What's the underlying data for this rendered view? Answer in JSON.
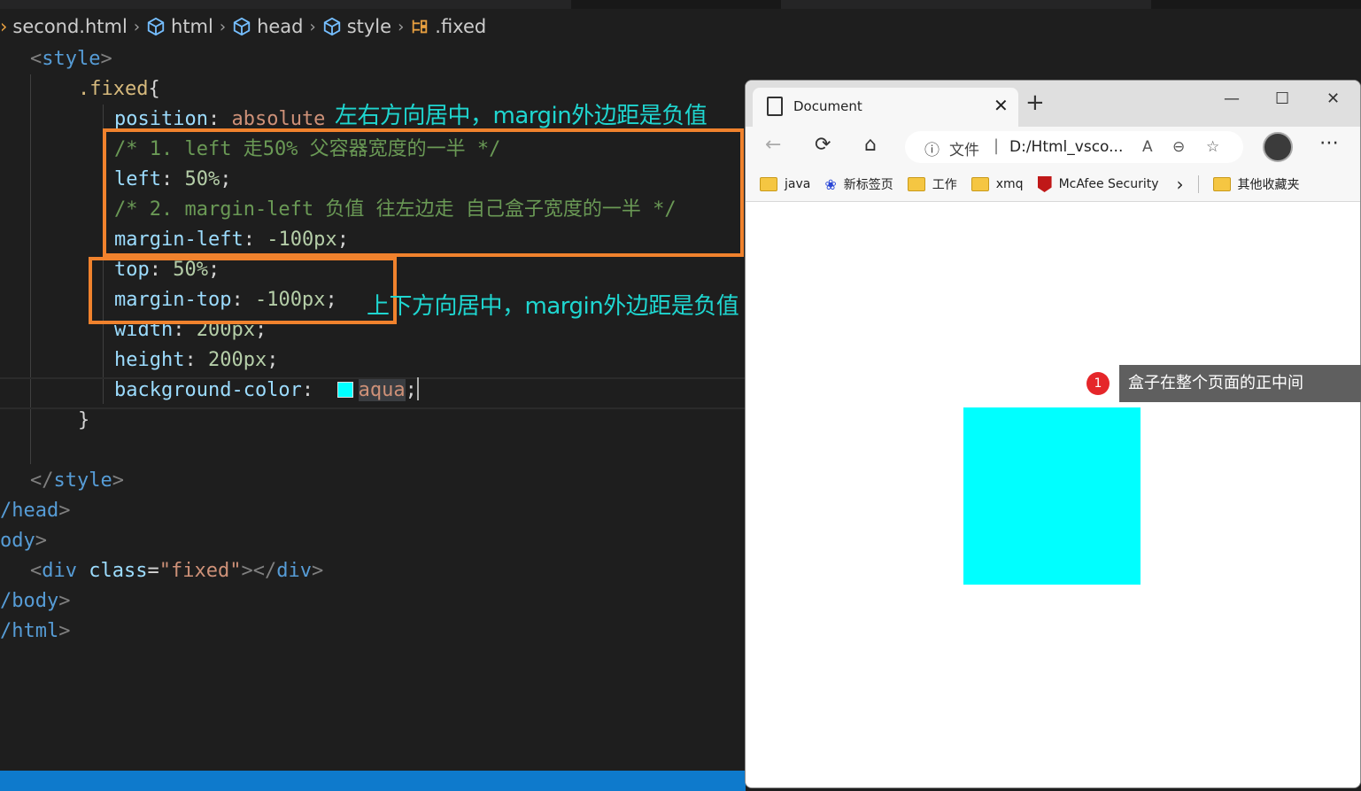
{
  "breadcrumb": {
    "file": "second.html",
    "items": [
      "html",
      "head",
      "style",
      ".fixed"
    ]
  },
  "code": {
    "l1_open": "<",
    "l1_tag": "style",
    "l1_close": ">",
    "l2_selector": ".fixed",
    "l2_brace": "{",
    "l3_prop": "position",
    "l3_val": "absolute",
    "l4_comment": "/* 1. left 走50% 父容器宽度的一半 */",
    "l5_prop": "left",
    "l5_val": "50%",
    "l6_comment": "/* 2. margin-left 负值 往左边走 自己盒子宽度的一半 */",
    "l7_prop": "margin-left",
    "l7_val": "-100px",
    "l8_prop": "top",
    "l8_val": "50%",
    "l9_prop": "margin-top",
    "l9_val": "-100px",
    "l10_prop": "width",
    "l10_val": "200px",
    "l11_prop": "height",
    "l11_val": "200px",
    "l12_prop": "background-color",
    "l12_val": "aqua",
    "l13_brace": "}",
    "l15_tag": "style",
    "l16_text": "/head",
    "l17_text": "ody",
    "l18_tag": "div",
    "l18_attr": "class",
    "l18_str": "\"fixed\"",
    "l19_text": "/body",
    "l20_text": "/html",
    "colon": ":",
    "semi": ";"
  },
  "annotations": {
    "horizontal": "左右方向居中，margin外边距是负值",
    "vertical": "上下方向居中，margin外边距是负值"
  },
  "browser": {
    "tab_title": "Document",
    "url_file_label": "文件",
    "url_text": "D:/Html_vsco...",
    "favorites": [
      "java",
      "新标签页",
      "工作",
      "xmq",
      "McAfee Security",
      "其他收藏夹"
    ],
    "box_color": "#00ffff"
  },
  "tooltip": {
    "badge": "1",
    "text": "盒子在整个页面的正中间"
  },
  "colors": {
    "highlight_box": "#f0822d",
    "annotation_text": "#1fd6d0",
    "status_bar": "#0e7acc"
  }
}
